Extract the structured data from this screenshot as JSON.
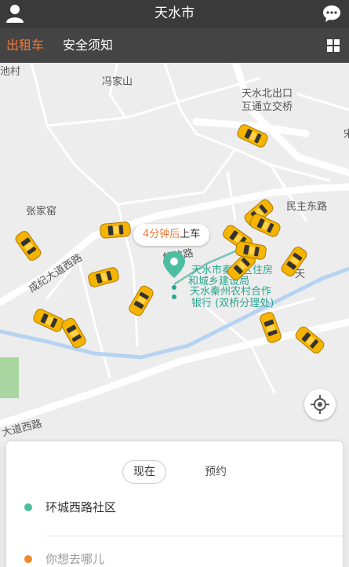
{
  "header": {
    "title": "天水市",
    "left_icon": "user-icon",
    "right_icon": "chat-icon"
  },
  "tabs": [
    {
      "label": "出租车",
      "active": true
    },
    {
      "label": "安全须知",
      "active": false
    }
  ],
  "tab_menu_icon": "grid-icon",
  "map": {
    "labels": {
      "village_top": "池村",
      "fengjiashan": "冯家山",
      "north_exit": "天水北出口",
      "interchange": "互通立交桥",
      "zhangjiayao": "张家窑",
      "minzhu_road": "民主东路",
      "chengji_road": "成纪大道西路",
      "jiefang_road": "解放路",
      "dadao_west": "大道西路",
      "edge_tian": "天",
      "edge_song": "宋"
    },
    "pois": {
      "line1": "天水市秦州区住房",
      "line2": "和城乡建设局",
      "line3": "天水秦州农村合作",
      "line4": "银行 (双桥分理处)"
    },
    "eta": {
      "minutes": "4分钟后",
      "suffix": "上车"
    },
    "car_count": 15,
    "colors": {
      "accent": "#f07a3a",
      "route_green": "#2aa58e",
      "river": "#b7d3f2",
      "car": "#f5b400"
    }
  },
  "locate_button_icon": "locate-icon",
  "booking": {
    "time_now": "现在",
    "time_reserve": "预约",
    "from_label": "环城西路社区",
    "to_placeholder": "你想去哪儿",
    "from_dot_color": "#4dbfa0",
    "to_dot_color": "#f0892d"
  }
}
